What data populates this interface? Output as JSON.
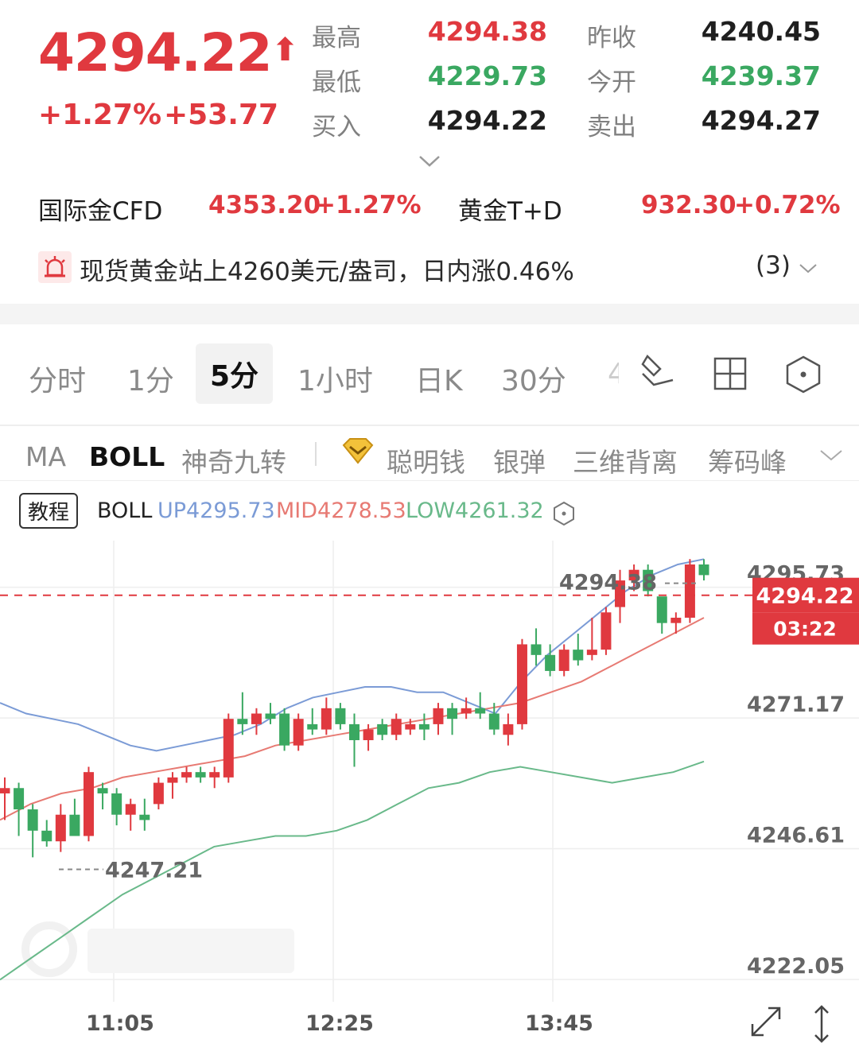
{
  "quote": {
    "price": "4294.22",
    "change_pct": "+1.27%",
    "change_abs": "+53.77",
    "high_label": "最高",
    "high": "4294.38",
    "low_label": "最低",
    "low": "4229.73",
    "bid_label": "买入",
    "bid": "4294.22",
    "prev_label": "昨收",
    "prev": "4240.45",
    "open_label": "今开",
    "open": "4239.37",
    "ask_label": "卖出",
    "ask": "4294.27"
  },
  "related": {
    "cfd_name": "国际金CFD",
    "cfd_price": "4353.20",
    "cfd_pct": "+1.27%",
    "td_name": "黄金T+D",
    "td_price": "932.30",
    "td_pct": "+0.72%"
  },
  "alert": {
    "text": "现货黄金站上4260美元/盎司，日内涨0.46%",
    "count": "(3)"
  },
  "tabs": [
    "分时",
    "1分",
    "5分",
    "1小时",
    "日K",
    "30分",
    "4"
  ],
  "active_tab": "5分",
  "indicators": [
    "MA",
    "BOLL",
    "神奇九转",
    "聪明钱",
    "银弹",
    "三维背离",
    "筹码峰"
  ],
  "tutorial": "教程",
  "boll": {
    "name": "BOLL",
    "up": "UP4295.73",
    "mid": "MID4278.53",
    "low": "LOW4261.32"
  },
  "colors": {
    "up": "#e0393f",
    "down": "#3aa861",
    "boll_up": "#7b9bd6",
    "boll_mid": "#e77a73",
    "boll_low": "#69b98a"
  },
  "chart_data": {
    "type": "candlestick",
    "y_ticks": [
      "4295.73",
      "4271.17",
      "4246.61",
      "4222.05"
    ],
    "x_ticks": [
      "11:05",
      "12:25",
      "13:45"
    ],
    "current_price": "4294.22",
    "countdown": "03:22",
    "max_marker": "4294.38",
    "min_marker": "4247.21",
    "ylim": [
      4222.05,
      4300.0
    ],
    "candles": [
      [
        4257,
        4260,
        4252,
        4258
      ],
      [
        4258,
        4259,
        4249,
        4254
      ],
      [
        4254,
        4255,
        4245,
        4250
      ],
      [
        4250,
        4252,
        4247,
        4248
      ],
      [
        4248,
        4255,
        4246,
        4253
      ],
      [
        4253,
        4256,
        4250,
        4249
      ],
      [
        4249,
        4262,
        4248,
        4261
      ],
      [
        4258,
        4259,
        4254,
        4257
      ],
      [
        4257,
        4258,
        4251,
        4253
      ],
      [
        4253,
        4256,
        4250,
        4255
      ],
      [
        4253,
        4256,
        4250,
        4252
      ],
      [
        4255,
        4260,
        4254,
        4259
      ],
      [
        4259,
        4261,
        4256,
        4260
      ],
      [
        4260,
        4262,
        4259,
        4261
      ],
      [
        4261,
        4262,
        4259,
        4260
      ],
      [
        4260,
        4262,
        4258,
        4261
      ],
      [
        4260,
        4272,
        4259,
        4271
      ],
      [
        4271,
        4276,
        4268,
        4270
      ],
      [
        4270,
        4273,
        4268,
        4272
      ],
      [
        4272,
        4274,
        4270,
        4271
      ],
      [
        4272,
        4273,
        4265,
        4266
      ],
      [
        4266,
        4272,
        4265,
        4271
      ],
      [
        4270,
        4273,
        4268,
        4269
      ],
      [
        4269,
        4275,
        4268,
        4273
      ],
      [
        4273,
        4274,
        4269,
        4270
      ],
      [
        4270,
        4272,
        4262,
        4267
      ],
      [
        4267,
        4270,
        4265,
        4269
      ],
      [
        4270,
        4271,
        4267,
        4268
      ],
      [
        4268,
        4272,
        4267,
        4271
      ],
      [
        4269,
        4271,
        4268,
        4270
      ],
      [
        4270,
        4272,
        4267,
        4269
      ],
      [
        4270,
        4274,
        4268,
        4273
      ],
      [
        4273,
        4274,
        4268,
        4271
      ],
      [
        4272,
        4275,
        4271,
        4273
      ],
      [
        4273,
        4276,
        4271,
        4272
      ],
      [
        4272,
        4274,
        4268,
        4269
      ],
      [
        4268,
        4272,
        4266,
        4270
      ],
      [
        4270,
        4286,
        4269,
        4285
      ],
      [
        4285,
        4288,
        4281,
        4283
      ],
      [
        4283,
        4285,
        4279,
        4280
      ],
      [
        4280,
        4285,
        4279,
        4284
      ],
      [
        4284,
        4287,
        4281,
        4282
      ],
      [
        4283,
        4290,
        4282,
        4284
      ],
      [
        4284,
        4292,
        4283,
        4291
      ],
      [
        4292,
        4299,
        4289,
        4297
      ],
      [
        4297,
        4300,
        4295,
        4299
      ],
      [
        4299,
        4300,
        4294,
        4295
      ],
      [
        4294,
        4293,
        4287,
        4289
      ],
      [
        4289,
        4291,
        4287,
        4290
      ],
      [
        4290,
        4301,
        4289,
        4300
      ],
      [
        4300,
        4301,
        4297,
        4298
      ]
    ],
    "boll_up": [
      4274,
      4272,
      4271,
      4270,
      4268,
      4266,
      4265,
      4266,
      4267,
      4268,
      4270,
      4273,
      4275,
      4276,
      4277,
      4277,
      4276,
      4276,
      4274,
      4272,
      4278,
      4283,
      4287,
      4291,
      4295,
      4298,
      4300,
      4301
    ],
    "boll_mid": [
      4252,
      4255,
      4257,
      4258,
      4260,
      4261,
      4262,
      4263,
      4264,
      4266,
      4267,
      4268,
      4269,
      4270,
      4271,
      4272,
      4273,
      4274,
      4276,
      4278,
      4281,
      4284,
      4287,
      4290
    ],
    "boll_low": [
      4222,
      4226,
      4230,
      4234,
      4238,
      4241,
      4244,
      4247,
      4248,
      4249,
      4249,
      4250,
      4252,
      4255,
      4258,
      4259,
      4261,
      4262,
      4261,
      4260,
      4259,
      4260,
      4261,
      4263
    ]
  }
}
